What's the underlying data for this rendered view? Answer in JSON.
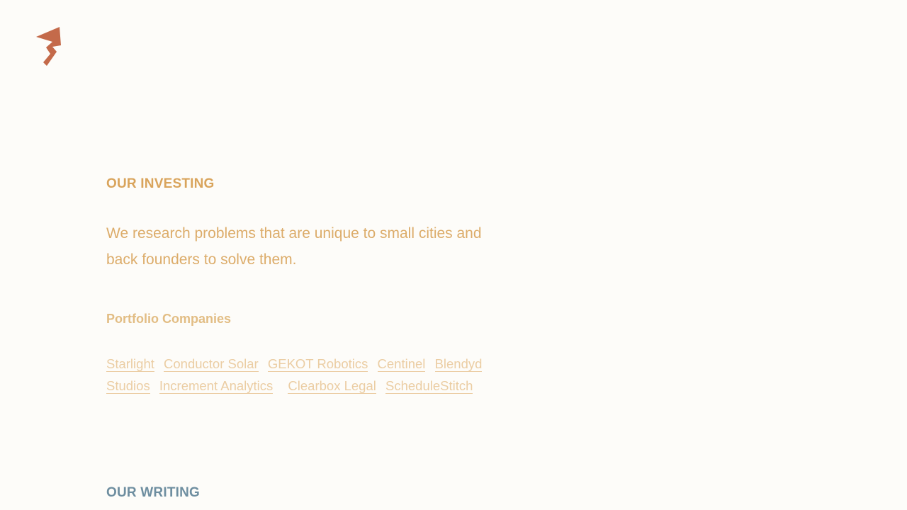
{
  "logo": {
    "icon": "lightning-bolt-logo",
    "color": "#c46a4a"
  },
  "investing": {
    "heading": "OUR INVESTING",
    "lede": "We research problems that are unique to small cities and back founders to solve them.",
    "portfolio_heading": "Portfolio Companies",
    "companies": [
      "Starlight",
      "Conductor Solar",
      "GEKOT Robotics",
      "Centinel",
      "Blendyd Studios",
      "Increment Analytics",
      "Clearbox Legal",
      "ScheduleStitch"
    ]
  },
  "writing": {
    "heading": "OUR WRITING"
  },
  "colors": {
    "background": "#fdfcf9",
    "accent_orange": "#d9a45c",
    "link": "#ebcda3",
    "writing_heading": "#6e8ea0"
  }
}
